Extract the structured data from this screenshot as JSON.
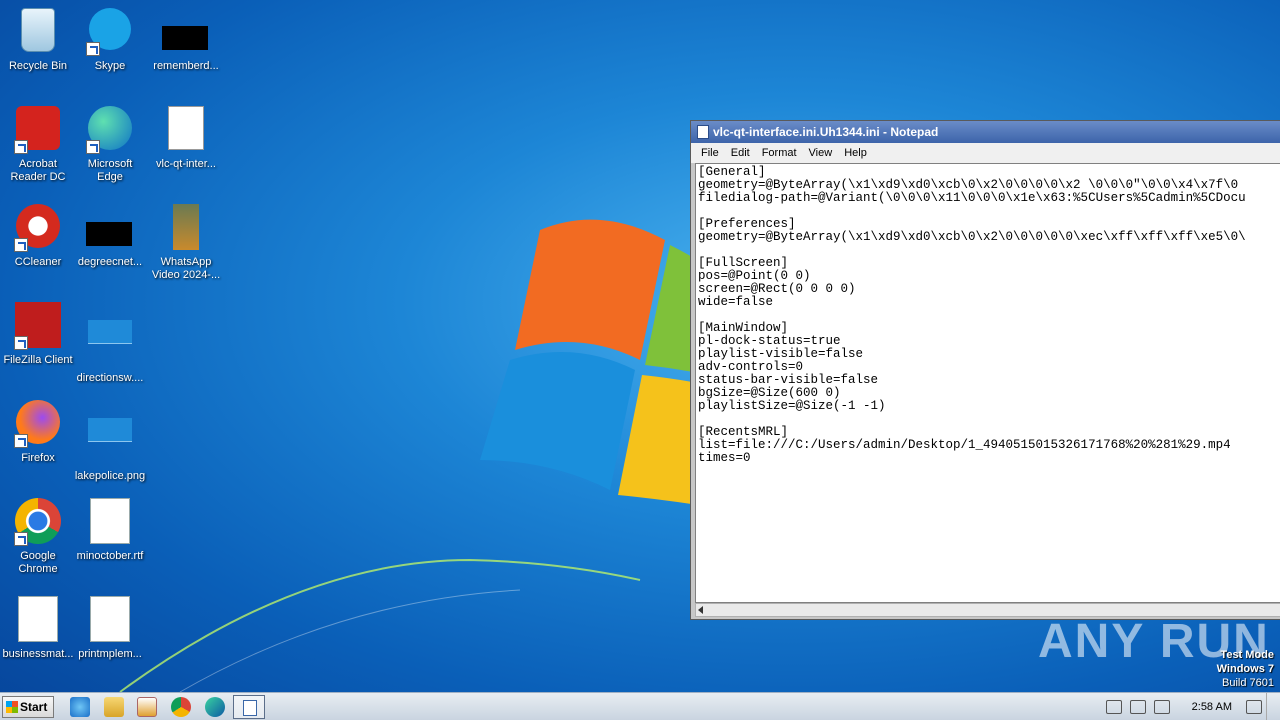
{
  "desktop_icons": [
    {
      "label": "Recycle Bin",
      "icon": "recycle-bin-icon"
    },
    {
      "label": "Skype",
      "icon": "skype-icon"
    },
    {
      "label": "rememberd...",
      "icon": "redacted-file-icon"
    },
    {
      "label": "Acrobat Reader DC",
      "icon": "acrobat-icon"
    },
    {
      "label": "Microsoft Edge",
      "icon": "edge-icon"
    },
    {
      "label": "vlc-qt-inter...",
      "icon": "settings-file-icon"
    },
    {
      "label": "CCleaner",
      "icon": "ccleaner-icon"
    },
    {
      "label": "degreecnet...",
      "icon": "redacted-file-icon"
    },
    {
      "label": "WhatsApp Video 2024-...",
      "icon": "video-thumbnail-icon"
    },
    {
      "label": "FileZilla Client",
      "icon": "filezilla-icon"
    },
    {
      "label": "directionsw....",
      "icon": "image-file-icon"
    },
    {
      "label": "Firefox",
      "icon": "firefox-icon"
    },
    {
      "label": "lakepolice.png",
      "icon": "image-file-icon"
    },
    {
      "label": "Google Chrome",
      "icon": "chrome-icon"
    },
    {
      "label": "minoctober.rtf",
      "icon": "word-doc-icon"
    },
    {
      "label": "businessmat...",
      "icon": "word-doc-icon"
    },
    {
      "label": "printmplem...",
      "icon": "word-doc-icon"
    }
  ],
  "notepad": {
    "title": "vlc-qt-interface.ini.Uh1344.ini - Notepad",
    "menu": [
      "File",
      "Edit",
      "Format",
      "View",
      "Help"
    ],
    "content": "[General]\ngeometry=@ByteArray(\\x1\\xd9\\xd0\\xcb\\0\\x2\\0\\0\\0\\0\\x2 \\0\\0\\0\"\\0\\0\\x4\\x7f\\0\nfiledialog-path=@Variant(\\0\\0\\0\\x11\\0\\0\\0\\x1e\\x63:%5CUsers%5Cadmin%5CDocu\n\n[Preferences]\ngeometry=@ByteArray(\\x1\\xd9\\xd0\\xcb\\0\\x2\\0\\0\\0\\0\\0\\xec\\xff\\xff\\xff\\xe5\\0\\\n\n[FullScreen]\npos=@Point(0 0)\nscreen=@Rect(0 0 0 0)\nwide=false\n\n[MainWindow]\npl-dock-status=true\nplaylist-visible=false\nadv-controls=0\nstatus-bar-visible=false\nbgSize=@Size(600 0)\nplaylistSize=@Size(-1 -1)\n\n[RecentsMRL]\nlist=file:///C:/Users/admin/Desktop/1_4940515015326171768%20%281%29.mp4\ntimes=0"
  },
  "watermark": "ANY RUN",
  "test_mode": {
    "line1": "Test Mode",
    "line2": "Windows 7",
    "line3": "Build 7601"
  },
  "taskbar": {
    "start_label": "Start",
    "clock": "2:58 AM"
  }
}
